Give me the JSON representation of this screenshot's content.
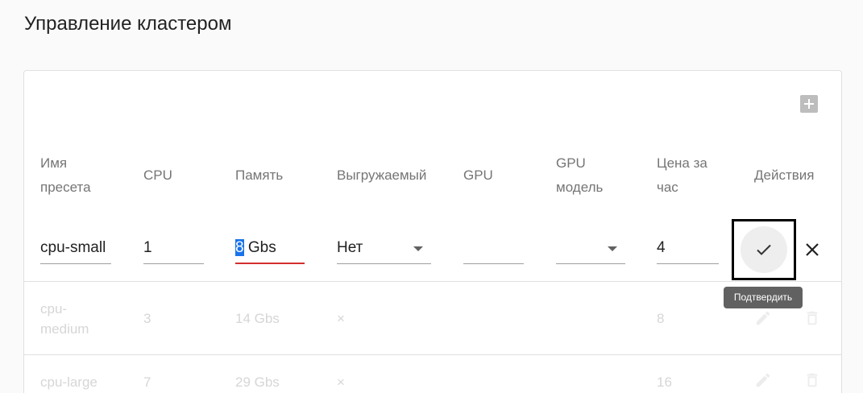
{
  "page": {
    "title": "Управление кластером"
  },
  "table": {
    "headers": {
      "name": "Имя пресета",
      "cpu": "CPU",
      "memory": "Память",
      "preemptible": "Выгружаемый",
      "gpu": "GPU",
      "gpu_model": "GPU модель",
      "price": "Цена за час",
      "actions": "Действия"
    },
    "edit_row": {
      "name": "cpu-small",
      "cpu": "1",
      "memory_selected": "8",
      "memory_rest": " Gbs",
      "preemptible": "Нет",
      "gpu": "",
      "gpu_model": "",
      "price": "4",
      "confirm_tooltip": "Подтвердить"
    },
    "rows": [
      {
        "name": "cpu-medium",
        "cpu": "3",
        "memory": "14 Gbs",
        "preemptible": "×",
        "price": "8"
      },
      {
        "name": "cpu-large",
        "cpu": "7",
        "memory": "29 Gbs",
        "preemptible": "×",
        "price": "16"
      }
    ]
  },
  "colors": {
    "accent": "#1a73e8",
    "error": "#d32f2f"
  }
}
